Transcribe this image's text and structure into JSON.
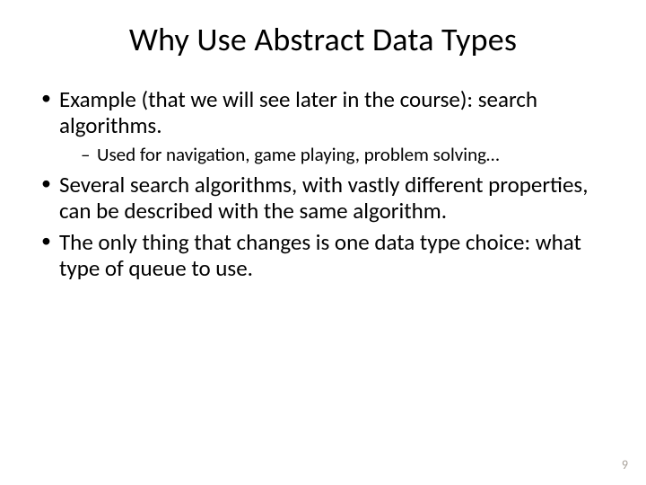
{
  "title": "Why Use Abstract Data Types",
  "bullets": {
    "b1": "Example (that we will see later in the course): search algorithms.",
    "b1a": "Used for navigation, game playing, problem solving…",
    "b2": "Several search algorithms, with vastly different properties, can be described with the same algorithm.",
    "b3": "The only thing that changes is one data type choice: what type of queue to use."
  },
  "page_number": "9"
}
